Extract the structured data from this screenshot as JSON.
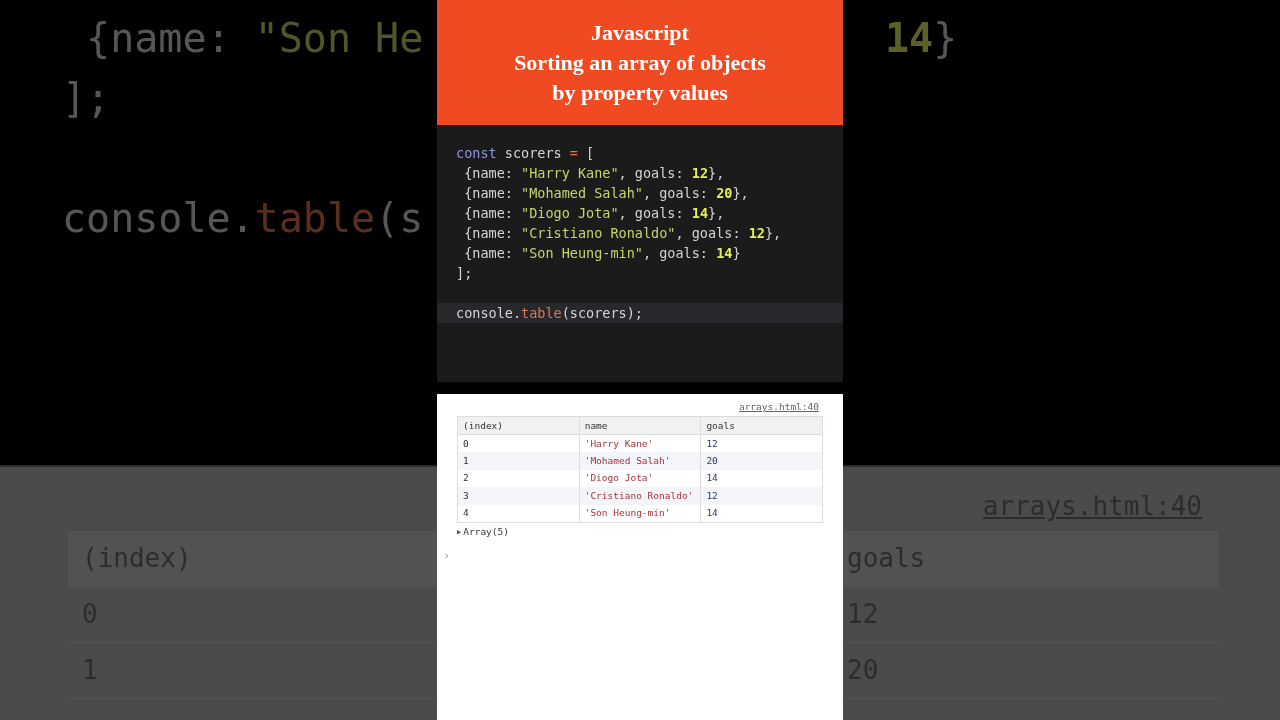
{
  "backdrop": {
    "left_code": [
      {
        "tokens": [
          {
            "kind": "punct",
            "text": " {"
          },
          {
            "kind": "key",
            "text": "name: "
          },
          {
            "kind": "string",
            "text": "\"Son He"
          }
        ]
      },
      {
        "tokens": [
          {
            "kind": "punct",
            "text": "];"
          }
        ]
      }
    ],
    "left_call": {
      "tokens": [
        {
          "kind": "ident",
          "text": "console."
        },
        {
          "kind": "method",
          "text": "table"
        },
        {
          "kind": "punct",
          "text": "(s"
        }
      ]
    },
    "left_table": [
      "(index)",
      "0",
      "1"
    ],
    "right_code": [
      {
        "tokens": [
          {
            "kind": "number",
            "text": "14"
          },
          {
            "kind": "punct",
            "text": "}"
          }
        ]
      }
    ],
    "right_link": "arrays.html:40",
    "right_table": [
      "goals",
      "12",
      "20"
    ]
  },
  "title": [
    "Javascript",
    "Sorting an array of objects",
    "by property values"
  ],
  "code": {
    "lines": [
      {
        "highlighted": false,
        "tokens": [
          {
            "kind": "keyword",
            "text": "const"
          },
          {
            "kind": "ident",
            "text": " scorers "
          },
          {
            "kind": "op",
            "text": "="
          },
          {
            "kind": "punct",
            "text": " ["
          }
        ]
      },
      {
        "highlighted": false,
        "tokens": [
          {
            "kind": "punct",
            "text": " {"
          },
          {
            "kind": "key",
            "text": "name: "
          },
          {
            "kind": "string",
            "text": "\"Harry Kane\""
          },
          {
            "kind": "punct",
            "text": ", goals: "
          },
          {
            "kind": "number",
            "text": "12"
          },
          {
            "kind": "punct",
            "text": "},"
          }
        ]
      },
      {
        "highlighted": false,
        "tokens": [
          {
            "kind": "punct",
            "text": " {"
          },
          {
            "kind": "key",
            "text": "name: "
          },
          {
            "kind": "string",
            "text": "\"Mohamed Salah\""
          },
          {
            "kind": "punct",
            "text": ", goals: "
          },
          {
            "kind": "number",
            "text": "20"
          },
          {
            "kind": "punct",
            "text": "},"
          }
        ]
      },
      {
        "highlighted": false,
        "tokens": [
          {
            "kind": "punct",
            "text": " {"
          },
          {
            "kind": "key",
            "text": "name: "
          },
          {
            "kind": "string",
            "text": "\"Diogo Jota\""
          },
          {
            "kind": "punct",
            "text": ", goals: "
          },
          {
            "kind": "number",
            "text": "14"
          },
          {
            "kind": "punct",
            "text": "},"
          }
        ]
      },
      {
        "highlighted": false,
        "tokens": [
          {
            "kind": "punct",
            "text": " {"
          },
          {
            "kind": "key",
            "text": "name: "
          },
          {
            "kind": "string",
            "text": "\"Cristiano Ronaldo\""
          },
          {
            "kind": "punct",
            "text": ", goals: "
          },
          {
            "kind": "number",
            "text": "12"
          },
          {
            "kind": "punct",
            "text": "},"
          }
        ]
      },
      {
        "highlighted": false,
        "tokens": [
          {
            "kind": "punct",
            "text": " {"
          },
          {
            "kind": "key",
            "text": "name: "
          },
          {
            "kind": "string",
            "text": "\"Son Heung-min\""
          },
          {
            "kind": "punct",
            "text": ", goals: "
          },
          {
            "kind": "number",
            "text": "14"
          },
          {
            "kind": "punct",
            "text": "}"
          }
        ]
      },
      {
        "highlighted": false,
        "tokens": [
          {
            "kind": "punct",
            "text": "];"
          }
        ]
      },
      {
        "blank_before": true,
        "highlighted": true,
        "tokens": [
          {
            "kind": "ident",
            "text": "console."
          },
          {
            "kind": "method",
            "text": "table"
          },
          {
            "kind": "punct",
            "text": "(scorers);"
          }
        ]
      }
    ]
  },
  "console": {
    "source_link": "arrays.html:40",
    "table": {
      "columns": [
        {
          "label": "(index)",
          "kind": "index"
        },
        {
          "label": "name",
          "kind": "string"
        },
        {
          "label": "goals",
          "kind": "number"
        }
      ],
      "rows": [
        [
          "0",
          "'Harry Kane'",
          "12"
        ],
        [
          "1",
          "'Mohamed Salah'",
          "20"
        ],
        [
          "2",
          "'Diogo Jota'",
          "14"
        ],
        [
          "3",
          "'Cristiano Ronaldo'",
          "12"
        ],
        [
          "4",
          "'Son Heung-min'",
          "14"
        ]
      ]
    },
    "summary": {
      "toggle": "▶",
      "text": "Array(5)"
    },
    "prompt": "›"
  }
}
